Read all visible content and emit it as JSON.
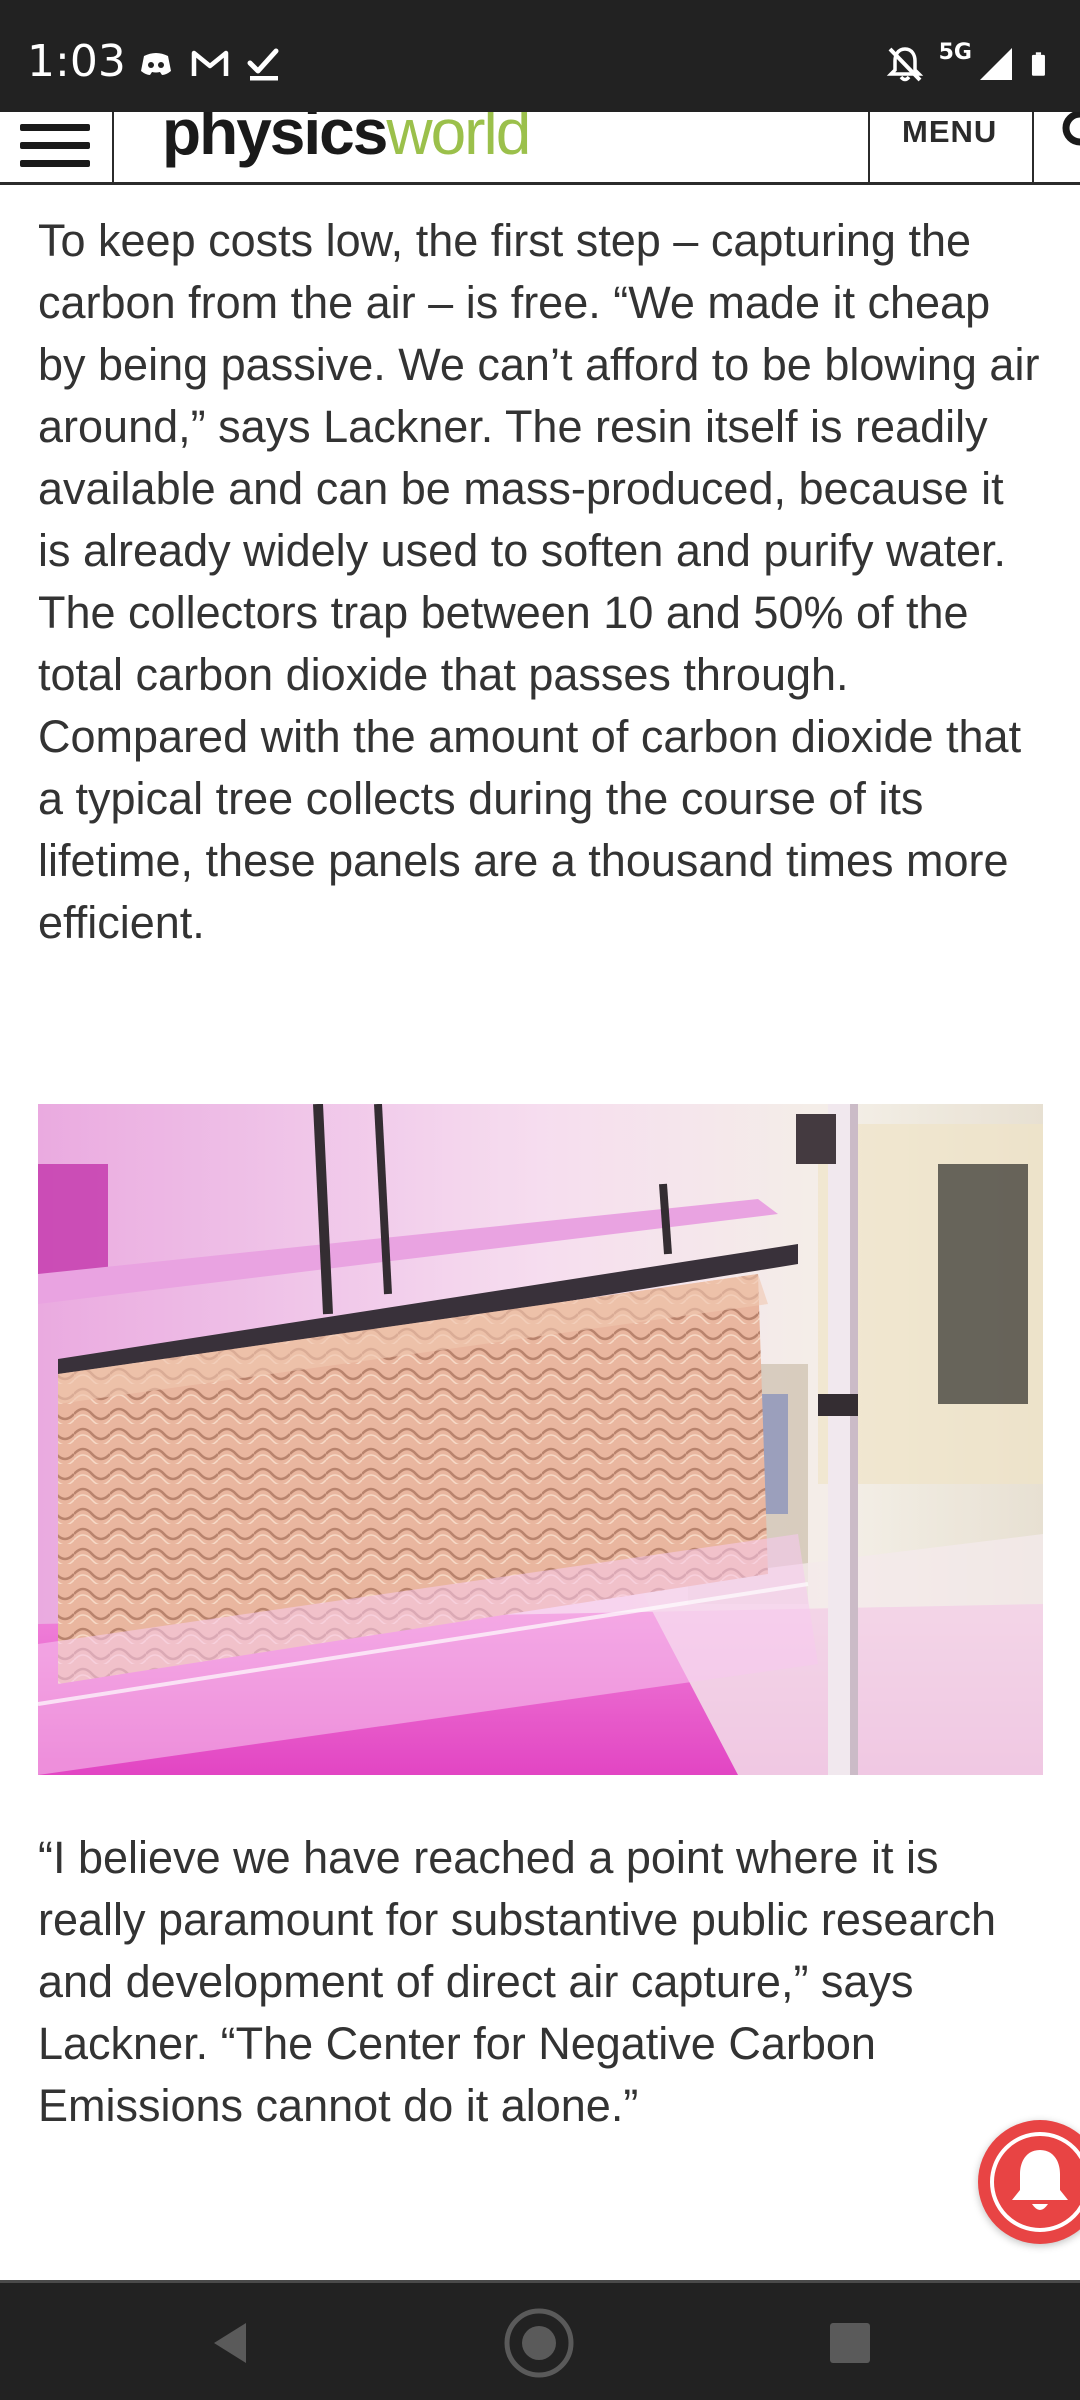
{
  "status_bar": {
    "time": "1:03",
    "network": "5G",
    "left_icons": [
      "discord-icon",
      "gmail-icon",
      "check-icon"
    ],
    "right_icons": [
      "notifications-off-icon",
      "signal-icon",
      "battery-icon"
    ]
  },
  "header": {
    "logo_part1": "physics",
    "logo_part2": "world",
    "menu_label": "MENU",
    "logo_color": "#9bc04b"
  },
  "article": {
    "paragraph1": "To keep costs low, the first step – capturing the carbon from the air – is free. “We made it cheap by being passive. We can’t afford to be blowing air around,” says Lackner. The resin itself is readily available and can be mass-produced, because it is already widely used to soften and purify water. The collectors trap between 10 and 50% of the total carbon dioxide that passes through. Compared with the amount of carbon dioxide that a typical tree collects during the course of its lifetime, these panels are a thousand times more efficient.",
    "paragraph2": "“I believe we have reached a point where it is really paramount for substantive public research and development of direct air capture,” says Lackner. “The Center for Negative Carbon Emissions cannot do it alone.”"
  },
  "colors": {
    "status_bar_bg": "#222222",
    "notification_red": "#e84444",
    "text": "#333333"
  }
}
